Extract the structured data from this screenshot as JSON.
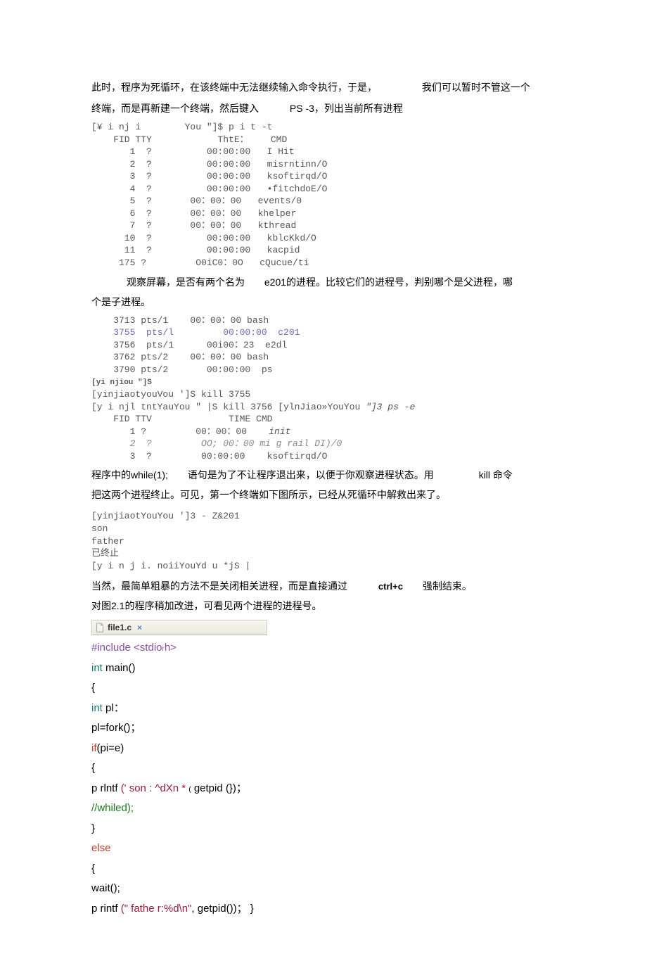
{
  "p1_a": "此时，程序为死循环，在该终端中无法继续输入命令执行，于是，",
  "p1_b": "我们可以暂时不管这一个",
  "p2_a": "终端，而是再新建一个终端，然后键入",
  "p2_b": "PS -3，列出当前所有进程",
  "term1": "[¥ i nj i        You \"]$ p i t -t\n    FID TTY            ThtE：    CMD\n       1  ?          00:00:00   I Hit\n       2  ?          00:00:00   misrntinn/O\n       3  ?          00:00:00   ksoftirqd/O\n       4  ?          00:00:00   •fitchdoE/O\n       5  ?       00：00：00   events/0\n       6  ?       00：00：00   khelper\n       7  ?       00：00：00   kthread\n      10  ?          00:00:00   kblcKkd/O\n      11  ?          00:00:00   kacpid\n     175 ?         O0iC0：0O   cQucue/ti",
  "p3_a": "观察屏幕，是否有两个名为",
  "p3_b": "e201的进程。比较它们的进程号，判别哪个是父进程，哪",
  "p4": "个是子进程。",
  "term2_l1": "    3713 pts/1    00：00：00 bash",
  "term2_l2": "    3755  pts/l         00:00:00  c201",
  "term2_l3": "    3756  pts/1      00i00：23  e2dl",
  "term2_l4": "    3762 pts/2    00：00：00 bash",
  "term2_l5": "    3790 pts/2       00:00:00  ps",
  "term2_l6": "[yi njiou \"]S",
  "term2_l7": "[yinjiaotyouVou ']S kill 3755",
  "term2_l8": "[y i njl tntYauYou \" |S kill 3756 [ylnJiao»YouYou ",
  "term2_l8b": "\"]3 ps -e",
  "term2_l9": "    FID TTV              TIME CMD",
  "term2_l10a": "       1 ?         00：00：00    ",
  "term2_l10b": "init",
  "term2_l11": "       2  ?         OO; 00：00 mi g rail DI)/0",
  "term2_l12": "       3  ?         00:00:00    ksoftirqd/O",
  "p5_a": "程序中的while(1);",
  "p5_b": "语句是为了不让程序退出来，以便于你观察进程状态。用",
  "p5_c": "kill 命令",
  "p6": "把这两个进程终止。可见，第一个终端如下图所示，已经从死循环中解救出来了。",
  "term3": "[yinjiaotYouYou ']3 - Z&201\nson\nfather\n已终止\n[y i n j i. noiiYouYd u *jS |",
  "p7_a": "当然，最简单粗暴的方法不是关闭相关进程，而是直接通过",
  "p7_b": "ctrl+c",
  "p7_c": "强制结束。",
  "p8": "对图2.1的程序稍加改进，可看见两个进程的进程号。",
  "tab_label": "file1.c",
  "tab_close": "×",
  "code": {
    "l1a": "#include ",
    "l1b": "<stdio",
    "l1c": "r",
    "l1d": "h>",
    "l2a": "int ",
    "l2b": "main()",
    "l3": "{",
    "l4a": "int ",
    "l4b": "pl：",
    "l5": "pl=fork()；",
    "l6a": "if",
    "l6b": "(pi=e)",
    "l7": "{",
    "l8a": "p rlntf ",
    "l8b": "(' son : ^dXn * ",
    "l8c": "(",
    "l8d": " getpid (})；",
    "l9": "//whiled);",
    "l10": "}",
    "l11": "else",
    "l12": "{",
    "l13": "wait();",
    "l14a": "p rintf ",
    "l14b": "(\" fathe r:%d\\n\"",
    "l14c": ", getpid())；  }"
  }
}
